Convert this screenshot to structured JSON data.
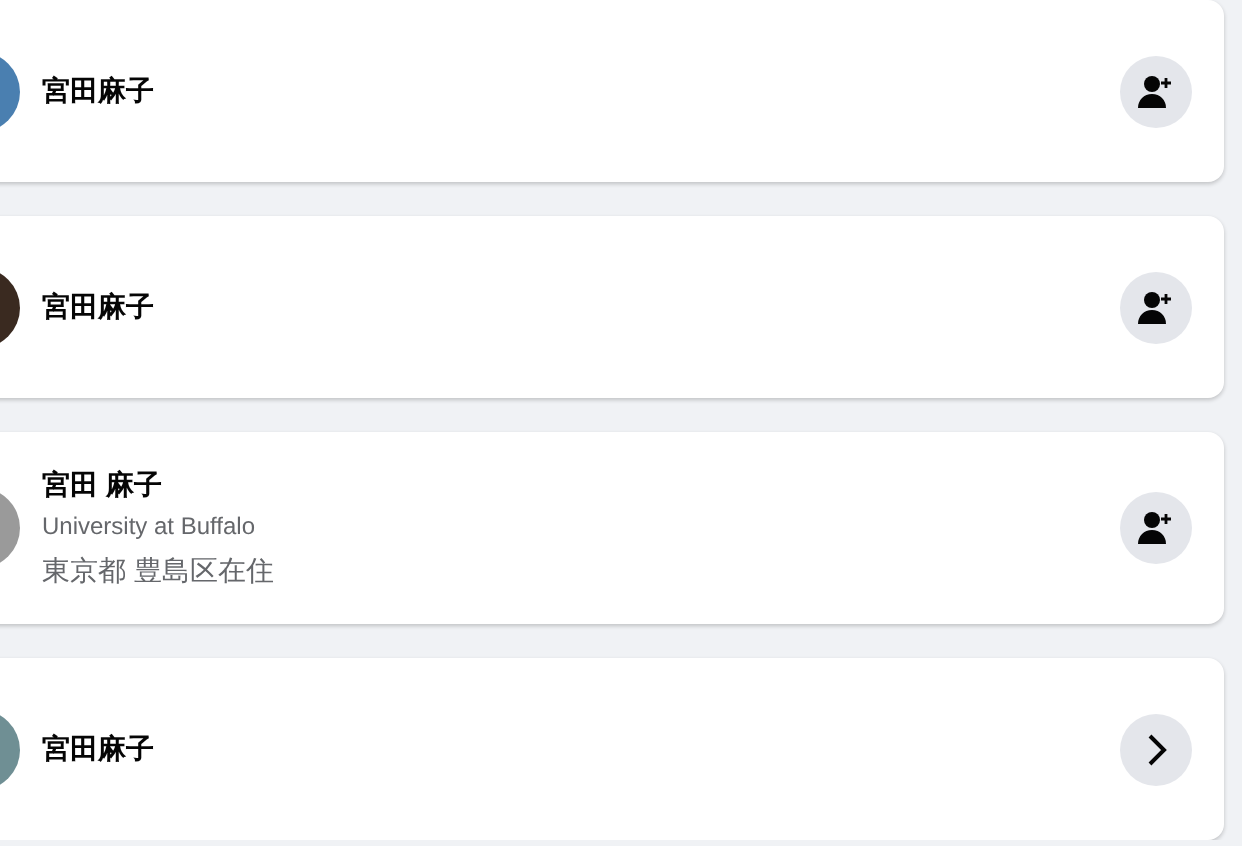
{
  "results": [
    {
      "name": "宮田麻子",
      "action": {
        "kind": "add-friend"
      }
    },
    {
      "name": "宮田麻子",
      "action": {
        "kind": "add-friend"
      }
    },
    {
      "name": "宮田 麻子",
      "details": [
        {
          "kind": "school",
          "text": "University at Buffalo"
        },
        {
          "kind": "location",
          "text": "東京都 豊島区在住"
        }
      ],
      "action": {
        "kind": "add-friend"
      }
    },
    {
      "name": "宮田麻子",
      "action": {
        "kind": "open"
      }
    }
  ]
}
